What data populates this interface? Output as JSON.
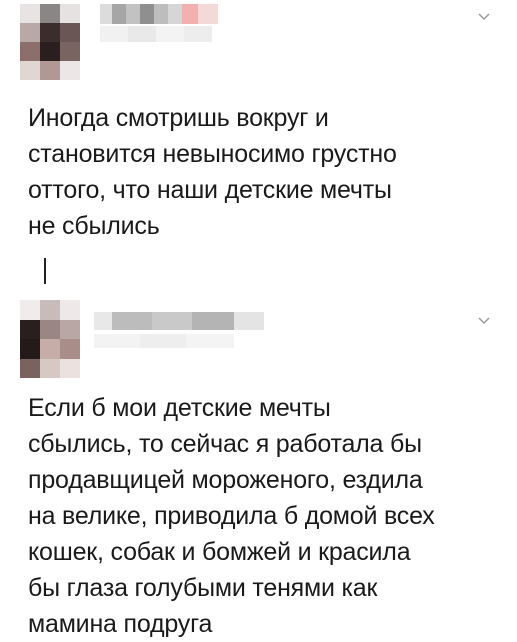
{
  "post1": {
    "text_lines": [
      "Иногда смотришь вокруг и",
      "становится невыносимо грустно",
      "оттого, что наши детские мечты",
      "не сбылись"
    ],
    "menu_icon": "chevron-down-icon"
  },
  "post2": {
    "text_lines": [
      "Если б мои детские мечты",
      "сбылись, то сейчас я работала бы",
      "продавщицей мороженого, ездила",
      "на велике, приводила б домой всех",
      "кошек, собак и бомжей и красила",
      "бы глаза голубыми тенями как",
      "мамина подруга"
    ],
    "menu_icon": "chevron-down-icon"
  },
  "colors": {
    "text": "#1a1a1a",
    "chevron": "#9a9aa0",
    "thread_line": "#222222"
  }
}
